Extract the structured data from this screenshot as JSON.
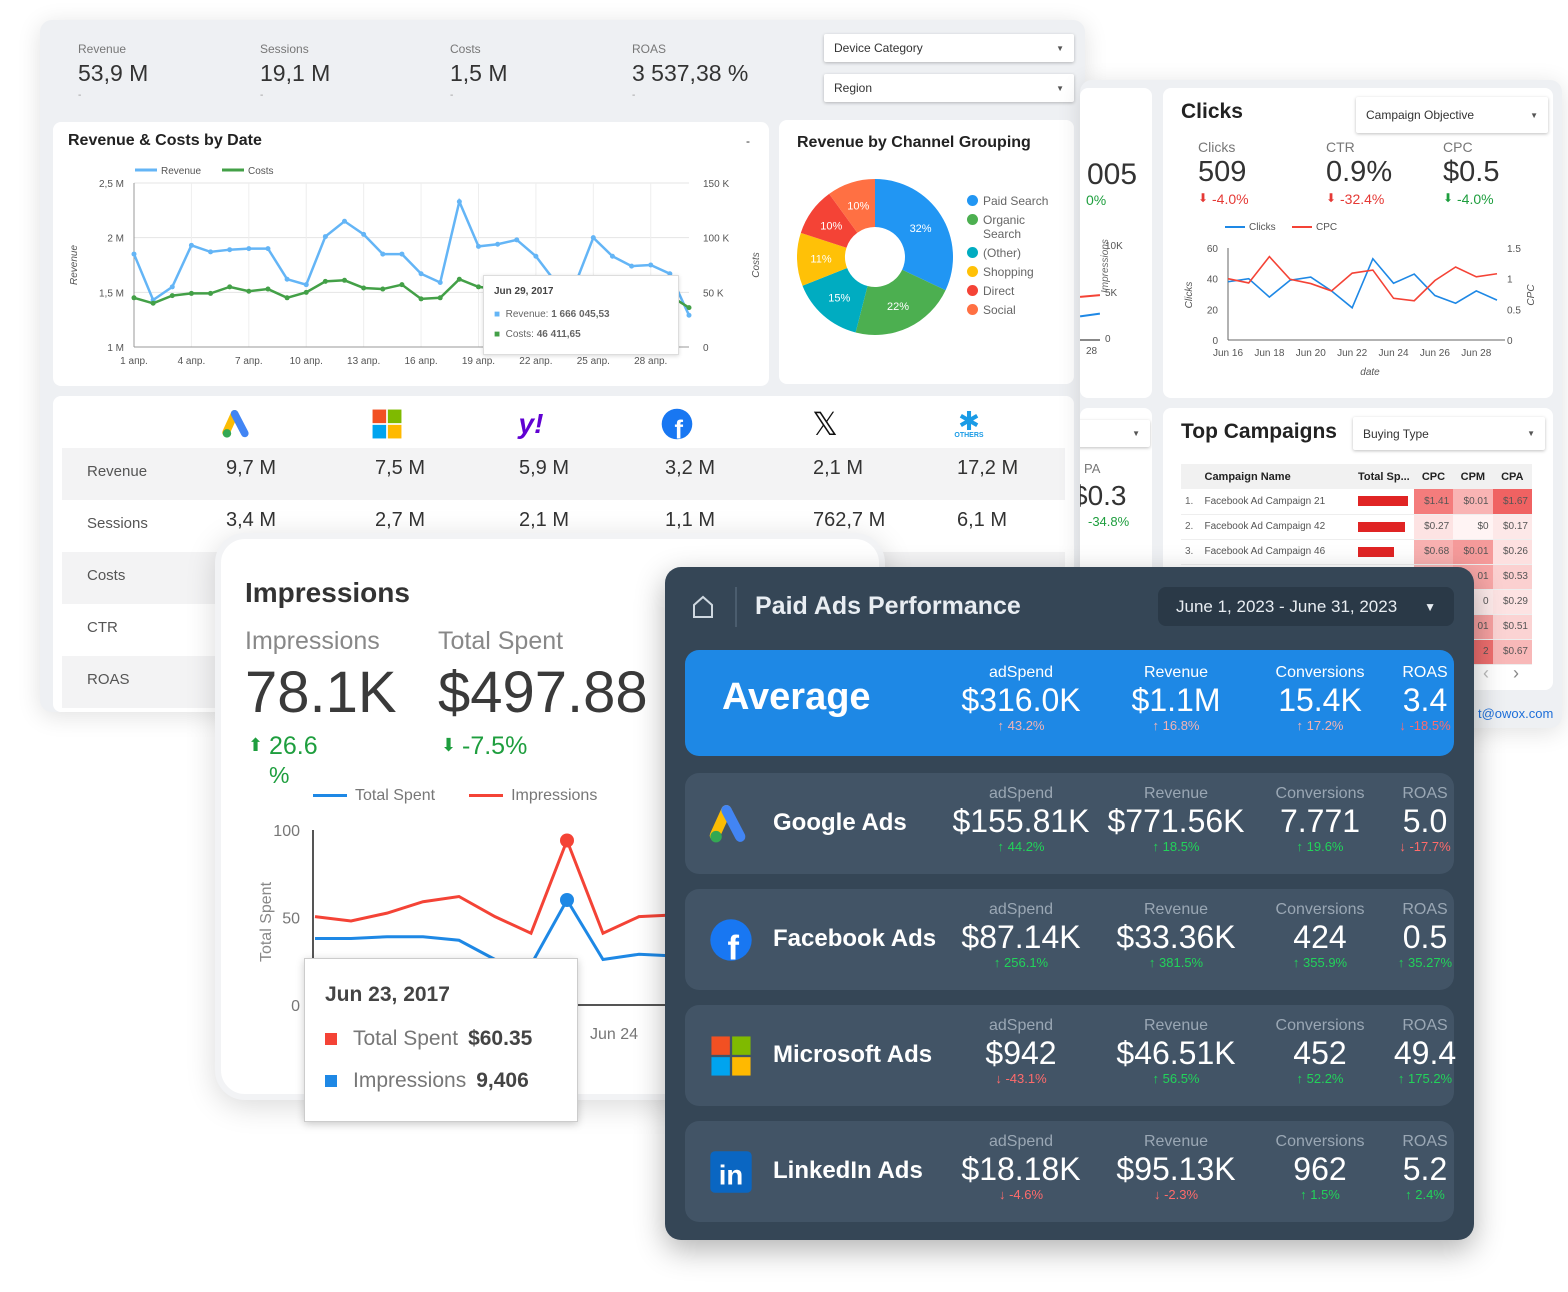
{
  "left_dashboard": {
    "kpis": [
      {
        "label": "Revenue",
        "value": "53,9 M",
        "delta": "-"
      },
      {
        "label": "Sessions",
        "value": "19,1 M",
        "delta": "-"
      },
      {
        "label": "Costs",
        "value": "1,5 M",
        "delta": "-"
      },
      {
        "label": "ROAS",
        "value": "3 537,38 %",
        "delta": "-"
      }
    ],
    "filters": {
      "device_category": "Device Category",
      "region": "Region"
    },
    "revenue_costs_card": {
      "title": "Revenue & Costs by Date",
      "menu": "-",
      "tooltip": {
        "date": "Jun 29, 2017",
        "revenue_label": "Revenue:",
        "revenue_value": "1 666 045,53",
        "costs_label": "Costs:",
        "costs_value": "46 411,65"
      }
    },
    "channel_card": {
      "title": "Revenue by Channel Grouping"
    },
    "channel_table": {
      "platforms": [
        {
          "icon": "google-ads-icon"
        },
        {
          "icon": "microsoft-icon"
        },
        {
          "icon": "yahoo-icon",
          "text": "y!"
        },
        {
          "icon": "facebook-icon"
        },
        {
          "icon": "x-icon",
          "text": "𝕏"
        },
        {
          "icon": "others-icon",
          "text": "✱",
          "caption": "OTHERS"
        }
      ],
      "rows": [
        {
          "label": "Revenue",
          "values": [
            "9,7 M",
            "7,5 M",
            "5,9 M",
            "3,2 M",
            "2,1 M",
            "17,2 M"
          ]
        },
        {
          "label": "Sessions",
          "values": [
            "3,4 M",
            "2,7 M",
            "2,1 M",
            "1,1 M",
            "762,7 M",
            "6,1 M"
          ]
        },
        {
          "label": "Costs",
          "values": []
        },
        {
          "label": "CTR",
          "values": []
        },
        {
          "label": "ROAS",
          "values": []
        }
      ]
    }
  },
  "right_dashboard": {
    "partial_card_top": {
      "value": "005",
      "delta": "0%",
      "ticks": [
        "10K",
        "5K",
        "0"
      ],
      "axis_label": "Impressions",
      "x_tick": "28"
    },
    "partial_card_bottom": {
      "label": "PA",
      "value": "$0.3",
      "delta": "-34.8%"
    },
    "clicks_card": {
      "title": "Clicks",
      "filter": "Campaign Objective",
      "kpis": [
        {
          "label": "Clicks",
          "value": "509",
          "delta": "-4.0%",
          "trend": "down",
          "color": "#e53935"
        },
        {
          "label": "CTR",
          "value": "0.9%",
          "delta": "-32.4%",
          "trend": "down",
          "color": "#e53935"
        },
        {
          "label": "CPC",
          "value": "$0.5",
          "delta": "-4.0%",
          "trend": "down",
          "color": "#1e9e3e"
        }
      ]
    },
    "top_campaigns": {
      "title": "Top Campaigns",
      "filter": "Buying Type",
      "columns": [
        "Campaign Name",
        "Total Sp...",
        "CPC",
        "CPM",
        "CPA"
      ],
      "rows": [
        {
          "n": "1.",
          "name": "Facebook Ad Campaign 21",
          "spend_share": 1.0,
          "cpc": "$1.41",
          "cpm": "$0.01",
          "cpa": "$1.67",
          "cpc_bg": "#f47c7c",
          "cpm_bg": "#f9b4b4",
          "cpa_bg": "#f06262"
        },
        {
          "n": "2.",
          "name": "Facebook Ad Campaign 42",
          "spend_share": 0.93,
          "cpc": "$0.27",
          "cpm": "$0",
          "cpa": "$0.17",
          "cpc_bg": "#fde3e3",
          "cpm_bg": "#fff4f4",
          "cpa_bg": "#fde8e8"
        },
        {
          "n": "3.",
          "name": "Facebook Ad Campaign 46",
          "spend_share": 0.72,
          "cpc": "$0.68",
          "cpm": "$0.01",
          "cpa": "$0.26",
          "cpc_bg": "#f8b0b0",
          "cpm_bg": "#f59a9a",
          "cpa_bg": "#fde0e0"
        },
        {
          "n": "",
          "name": "",
          "cpc": "",
          "cpm": "01",
          "cpa": "$0.53",
          "cpc_bg": "#f8b8b8",
          "cpm_bg": "#f7a6a6",
          "cpa_bg": "#fbd0d0"
        },
        {
          "n": "",
          "name": "",
          "cpc": "",
          "cpm": "0",
          "cpa": "$0.29",
          "cpc_bg": "#fde3e3",
          "cpm_bg": "#fdeaea",
          "cpa_bg": "#fde3e3"
        },
        {
          "n": "",
          "name": "",
          "cpc": "",
          "cpm": "01",
          "cpa": "$0.51",
          "cpc_bg": "#f8b8b8",
          "cpm_bg": "#f6a0a0",
          "cpa_bg": "#fbd3d3"
        },
        {
          "n": "",
          "name": "",
          "cpc": "",
          "cpm": "2",
          "cpa": "$0.67",
          "cpc_bg": "#f49090",
          "cpm_bg": "#ee6e6e",
          "cpa_bg": "#f8b8b8"
        }
      ],
      "prev": "‹",
      "next": "›"
    },
    "contact": "t@owox.com"
  },
  "impressions_card": {
    "title": "Impressions",
    "kpis": [
      {
        "label": "Impressions",
        "value": "78.1K",
        "delta": "26.6",
        "delta_unit": "%",
        "trend": "up"
      },
      {
        "label": "Total Spent",
        "value": "$497.88",
        "delta": "-7.5%",
        "trend": "down"
      }
    ],
    "tooltip": {
      "date": "Jun 23, 2017",
      "rows": [
        {
          "label": "Total Spent",
          "value": "$60.35",
          "color": "#f44336"
        },
        {
          "label": "Impressions",
          "value": "9,406",
          "color": "#1e88e5"
        }
      ]
    }
  },
  "paid_ads": {
    "title": "Paid Ads Performance",
    "date_range": "June 1, 2023 - June 31, 2023",
    "columns": [
      "adSpend",
      "Revenue",
      "Conversions",
      "ROAS"
    ],
    "average": {
      "label": "Average",
      "values": [
        "$316.0K",
        "$1.1M",
        "15.4K",
        "3.4"
      ],
      "deltas": [
        "43.2%",
        "16.8%",
        "17.2%",
        "-18.5%"
      ],
      "trends": [
        "up",
        "up",
        "up",
        "down"
      ]
    },
    "platforms": [
      {
        "name": "Google Ads",
        "icon": "google-ads-icon",
        "values": [
          "$155.81K",
          "$771.56K",
          "7.771",
          "5.0"
        ],
        "deltas": [
          "44.2%",
          "18.5%",
          "19.6%",
          "-17.7%"
        ],
        "trends": [
          "up",
          "up",
          "up",
          "down"
        ]
      },
      {
        "name": "Facebook Ads",
        "icon": "facebook-icon",
        "values": [
          "$87.14K",
          "$33.36K",
          "424",
          "0.5"
        ],
        "deltas": [
          "256.1%",
          "381.5%",
          "355.9%",
          "35.27%"
        ],
        "trends": [
          "up",
          "up",
          "up",
          "up"
        ]
      },
      {
        "name": "Microsoft Ads",
        "icon": "microsoft-icon",
        "values": [
          "$942",
          "$46.51K",
          "452",
          "49.4"
        ],
        "deltas": [
          "-43.1%",
          "56.5%",
          "52.2%",
          "175.2%"
        ],
        "trends": [
          "down",
          "up",
          "up",
          "up"
        ]
      },
      {
        "name": "LinkedIn Ads",
        "icon": "linkedin-icon",
        "values": [
          "$18.18K",
          "$95.13K",
          "962",
          "5.2"
        ],
        "deltas": [
          "-4.6%",
          "-2.3%",
          "1.5%",
          "2.4%"
        ],
        "trends": [
          "down",
          "down",
          "up",
          "up"
        ]
      }
    ]
  },
  "colors": {
    "revenue": "#64b5f6",
    "costs": "#43a047",
    "blue": "#1e88e5",
    "red": "#f44336",
    "dark_bg": "#354656",
    "avg_bg": "#1e88e5",
    "up": "#22d35a",
    "down": "#ff6b6b"
  },
  "chart_data": [
    {
      "type": "line",
      "title": "Revenue & Costs by Date",
      "x": [
        "1 апр.",
        "2 апр.",
        "3 апр.",
        "4 апр.",
        "5 апр.",
        "6 апр.",
        "7 апр.",
        "8 апр.",
        "9 апр.",
        "10 апр.",
        "11 апр.",
        "12 апр.",
        "13 апр.",
        "14 апр.",
        "15 апр.",
        "16 апр.",
        "17 апр.",
        "18 апр.",
        "19 апр.",
        "20 апр.",
        "21 апр.",
        "22 апр.",
        "23 апр.",
        "24 апр.",
        "25 апр.",
        "26 апр.",
        "27 апр.",
        "28 апр.",
        "29 апр.",
        "30 апр."
      ],
      "x_ticks": [
        "1 апр.",
        "4 апр.",
        "7 апр.",
        "10 апр.",
        "13 апр.",
        "16 апр.",
        "19 апр.",
        "22 апр.",
        "25 апр.",
        "28 апр."
      ],
      "series": [
        {
          "name": "Revenue",
          "axis": "left",
          "values": [
            1.85,
            1.43,
            1.55,
            1.93,
            1.87,
            1.89,
            1.9,
            1.9,
            1.62,
            1.57,
            2.01,
            2.15,
            2.03,
            1.85,
            1.85,
            1.67,
            1.59,
            2.33,
            1.92,
            1.94,
            1.98,
            1.83,
            1.6,
            1.55,
            2.0,
            1.83,
            1.74,
            1.75,
            1.67,
            1.29
          ]
        },
        {
          "name": "Costs",
          "axis": "right",
          "values": [
            45,
            40,
            47,
            49,
            49,
            55,
            51,
            53,
            45,
            50,
            60,
            61,
            54,
            53,
            57,
            44,
            45,
            62,
            55,
            53,
            52,
            52,
            53,
            54,
            55,
            55,
            55,
            55,
            47,
            36
          ]
        }
      ],
      "ylabel": "Revenue",
      "y2label": "Costs",
      "y_ticks": [
        "1 M",
        "1,5 M",
        "2 M",
        "2,5 M"
      ],
      "ylim": [
        1,
        2.5
      ],
      "y2_ticks": [
        "0",
        "50 K",
        "100 K",
        "150 K"
      ],
      "y2lim": [
        0,
        150
      ],
      "legend": "top-left",
      "grid": true
    },
    {
      "type": "pie",
      "title": "Revenue by Channel Grouping",
      "donut": true,
      "categories": [
        "Paid Search",
        "Organic Search",
        "(Other)",
        "Shopping",
        "Direct",
        "Social"
      ],
      "values": [
        32,
        22,
        15,
        11,
        10,
        10
      ],
      "labels": [
        "32%",
        "22%",
        "15%",
        "11%",
        "10%",
        "10%"
      ],
      "colors": [
        "#2196f3",
        "#4caf50",
        "#00acc1",
        "#ffc107",
        "#f44336",
        "#ff7043"
      ],
      "legend": "right"
    },
    {
      "type": "line",
      "x": [
        "Jun 16",
        "Jun 17",
        "Jun 18",
        "Jun 19",
        "Jun 20",
        "Jun 21",
        "Jun 22",
        "Jun 23",
        "Jun 24",
        "Jun 25",
        "Jun 26",
        "Jun 27",
        "Jun 28",
        "Jun 29"
      ],
      "x_ticks": [
        "Jun 16",
        "Jun 18",
        "Jun 20",
        "Jun 22",
        "Jun 24",
        "Jun 26",
        "Jun 28"
      ],
      "series": [
        {
          "name": "Clicks",
          "axis": "left",
          "color": "#1e88e5",
          "values": [
            38,
            40,
            28,
            39,
            41,
            32,
            21,
            53,
            37,
            43,
            29,
            24,
            32,
            26
          ]
        },
        {
          "name": "CPC",
          "axis": "right",
          "color": "#f44336",
          "values": [
            1.0,
            0.93,
            1.36,
            0.99,
            0.92,
            0.8,
            1.09,
            1.14,
            0.68,
            0.64,
            0.97,
            1.19,
            1.03,
            1.08
          ]
        }
      ],
      "xlabel": "date",
      "ylabel": "Clicks",
      "y2label": "CPC",
      "y_ticks": [
        "0",
        "20",
        "40",
        "60"
      ],
      "ylim": [
        0,
        60
      ],
      "y2_ticks": [
        "0",
        "0.5",
        "1",
        "1.5"
      ],
      "y2lim": [
        0,
        1.5
      ],
      "legend": "top"
    },
    {
      "type": "line",
      "x_ticks": [
        "Jun 24"
      ],
      "series": [
        {
          "name": "Total Spent",
          "color": "#1e88e5",
          "values": [
            38,
            38,
            39,
            39,
            37,
            26,
            23,
            60,
            26,
            29,
            28
          ]
        },
        {
          "name": "Impressions",
          "color": "#f44336",
          "values": [
            50.5,
            48,
            52.5,
            59,
            62,
            50.5,
            41,
            94,
            41,
            50.5,
            51.5
          ]
        }
      ],
      "ylabel": "Total Spent",
      "y_ticks": [
        "0",
        "50",
        "100"
      ],
      "ylim": [
        0,
        100
      ],
      "legend": "top",
      "highlight_index": 7
    }
  ]
}
